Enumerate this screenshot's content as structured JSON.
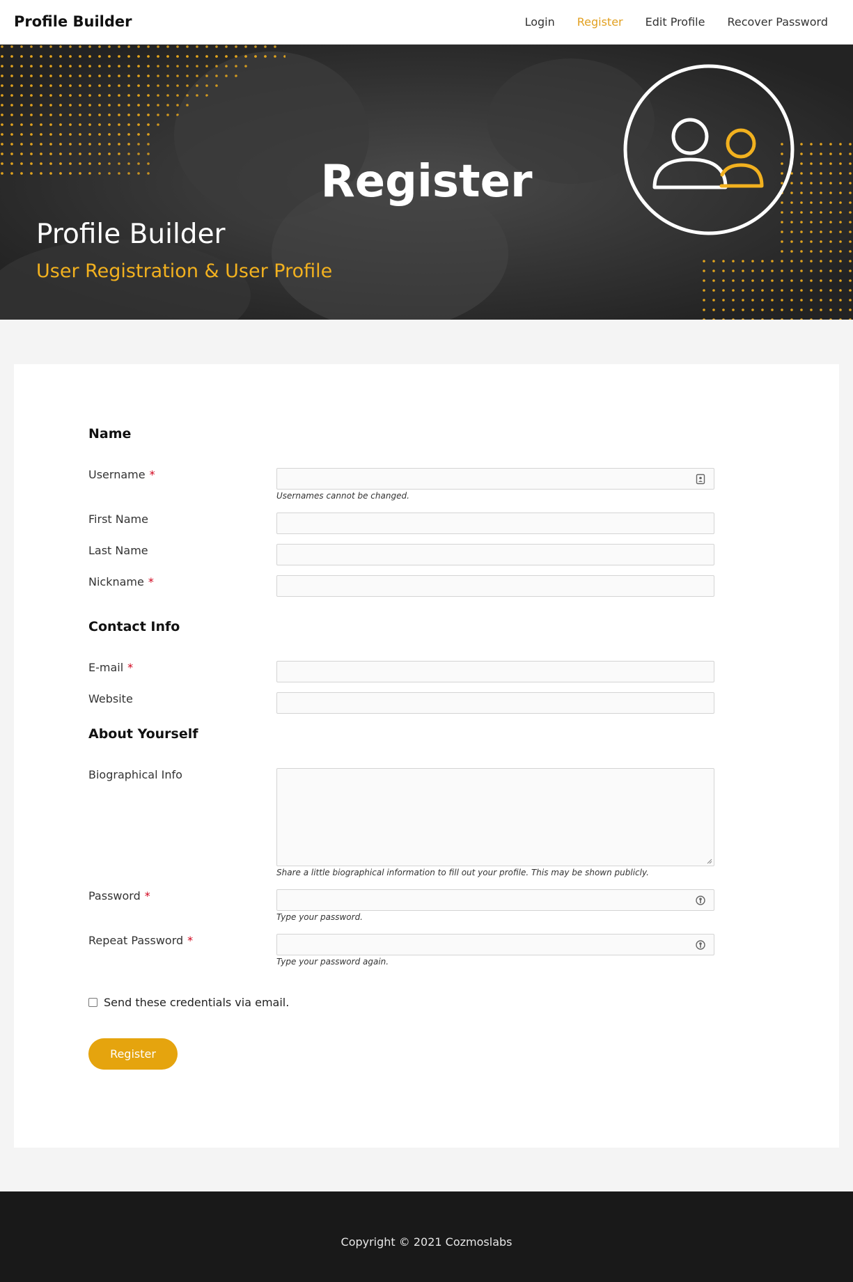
{
  "header": {
    "site_title": "Profile Builder",
    "nav": [
      {
        "label": "Login",
        "active": false
      },
      {
        "label": "Register",
        "active": true
      },
      {
        "label": "Edit Profile",
        "active": false
      },
      {
        "label": "Recover Password",
        "active": false
      }
    ]
  },
  "hero": {
    "title": "Register",
    "brand": "Profile Builder",
    "tagline": "User Registration & User Profile",
    "icon": "users-icon",
    "accent_color": "#f2b11f"
  },
  "form": {
    "sections": {
      "name": "Name",
      "contact": "Contact Info",
      "about": "About Yourself"
    },
    "fields": {
      "username": {
        "label": "Username",
        "required": "*",
        "value": "",
        "hint": "Usernames cannot be changed.",
        "icon": "contact-card-icon"
      },
      "first_name": {
        "label": "First Name",
        "value": ""
      },
      "last_name": {
        "label": "Last Name",
        "value": ""
      },
      "nickname": {
        "label": "Nickname",
        "required": "*",
        "value": ""
      },
      "email": {
        "label": "E-mail",
        "required": "*",
        "value": ""
      },
      "website": {
        "label": "Website",
        "value": ""
      },
      "bio": {
        "label": "Biographical Info",
        "value": "",
        "hint": "Share a little biographical information to fill out your profile. This may be shown publicly."
      },
      "password": {
        "label": "Password",
        "required": "*",
        "value": "",
        "hint": "Type your password.",
        "icon": "key-icon"
      },
      "repeat_password": {
        "label": "Repeat Password",
        "required": "*",
        "value": "",
        "hint": "Type your password again.",
        "icon": "key-icon"
      }
    },
    "send_credentials": {
      "label": "Send these credentials via email.",
      "checked": false
    },
    "submit_label": "Register",
    "button_color": "#e5a40e"
  },
  "footer": {
    "copyright": "Copyright © 2021 Cozmoslabs"
  }
}
